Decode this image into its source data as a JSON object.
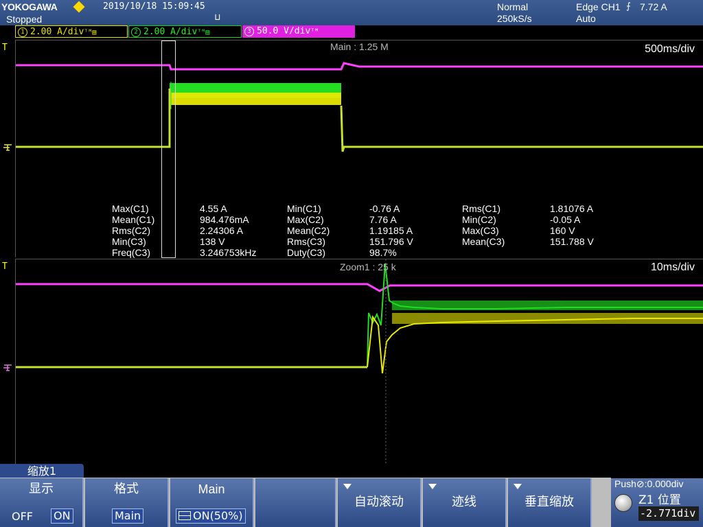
{
  "header": {
    "brand": "YOKOGAWA",
    "status": "Stopped",
    "datetime": "2019/10/18  15:09:45",
    "usb_icon": "⊔",
    "acq_mode": "Normal",
    "sample_rate": "250kS/s",
    "trigger_source": "Edge CH1",
    "trigger_slope": "⨍",
    "trigger_level": "7.72 A",
    "trigger_mode": "Auto"
  },
  "channels": [
    {
      "num": "1",
      "label": "2.00 A/div",
      "probe": "ᵀᴹ▤",
      "color": "#e8e000"
    },
    {
      "num": "2",
      "label": "2.00 A/div",
      "probe": "ᵀᴹ▤",
      "color": "#22ee22"
    },
    {
      "num": "3",
      "label": "50.0 V/div",
      "probe": "ᵀᴹ",
      "color": "#e020e0"
    }
  ],
  "main_view": {
    "title": "Main : 1.25 M",
    "time_div": "500ms/div",
    "trigger_marker": "T"
  },
  "zoom_view": {
    "title": "Zoom1 : 25 k",
    "time_div": "10ms/div",
    "trigger_marker": "T"
  },
  "measurements": [
    {
      "label": "Max(C1)",
      "value": "4.55 A"
    },
    {
      "label": "Min(C1)",
      "value": "-0.76 A"
    },
    {
      "label": "Rms(C1)",
      "value": "1.81076 A"
    },
    {
      "label": "Mean(C1)",
      "value": "984.476mA"
    },
    {
      "label": "Max(C2)",
      "value": "7.76 A"
    },
    {
      "label": "Min(C2)",
      "value": "-0.05 A"
    },
    {
      "label": "Rms(C2)",
      "value": "2.24306 A"
    },
    {
      "label": "Mean(C2)",
      "value": "1.19185 A"
    },
    {
      "label": "Max(C3)",
      "value": "160 V"
    },
    {
      "label": "Min(C3)",
      "value": "138 V"
    },
    {
      "label": "Rms(C3)",
      "value": "151.796 V"
    },
    {
      "label": "Mean(C3)",
      "value": "151.788 V"
    },
    {
      "label": "Freq(C3)",
      "value": "3.246753kHz"
    },
    {
      "label": "Duty(C3)",
      "value": "98.7%"
    }
  ],
  "softkeys": {
    "menu_tab": "缩放1",
    "display": {
      "title": "显示",
      "off": "OFF",
      "on": "ON"
    },
    "format": {
      "title": "格式",
      "value": "Main"
    },
    "main": {
      "title": "Main",
      "value": "ON(50%)"
    },
    "auto_scroll": "自动滚动",
    "trace": "迹线",
    "vertical_zoom": "垂直缩放"
  },
  "knob": {
    "push_label": "Push⊘:0.000div",
    "z1_label": "Z1  位置",
    "z1_value": "-2.771div"
  }
}
